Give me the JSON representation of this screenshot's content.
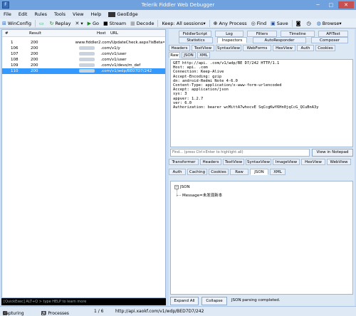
{
  "window": {
    "title": "Telerik Fiddler Web Debugger"
  },
  "menu": [
    "File",
    "Edit",
    "Rules",
    "Tools",
    "View",
    "Help",
    "GeoEdge"
  ],
  "toolbar": {
    "winconfig": "WinConfig",
    "replay": "Replay",
    "go": "Go",
    "stream": "Stream",
    "decode": "Decode",
    "keep": "Keep: All sessions",
    "any_process": "Any Process",
    "find": "Find",
    "save": "Save",
    "browse": "Browse"
  },
  "sessions": {
    "headers": [
      "#",
      "Result",
      "Host",
      "URL"
    ],
    "rows": [
      {
        "id": "1",
        "result": "200",
        "host": "www.fiddler2.com",
        "url": "/UpdateCheck.aspx?isBeta=",
        "selected": false
      },
      {
        "id": "106",
        "result": "200",
        "host": ".com",
        "url": "/v1/y",
        "selected": false
      },
      {
        "id": "107",
        "result": "200",
        "host": ".com",
        "url": "/v1/user",
        "selected": false
      },
      {
        "id": "108",
        "result": "200",
        "host": ".com",
        "url": "/v1/user",
        "selected": false
      },
      {
        "id": "109",
        "result": "200",
        "host": ".com",
        "url": "/v1/devs/m_def",
        "selected": false
      },
      {
        "id": "110",
        "result": "200",
        "host": ".com",
        "url": "/v1/wdp/BE07D7/242",
        "selected": true
      }
    ]
  },
  "quickexec": "[QuickExec] ALT+Q > type HELP to learn more",
  "status": {
    "capturing": "Capturing",
    "processes": "All Processes",
    "count": "1 / 6",
    "url": "http://api.xaokf.com/v1/wdp/BED7D7/242"
  },
  "right": {
    "top_tabs_row1": [
      "FiddlerScript",
      "Log",
      "Filters",
      "Timeline",
      "APITest"
    ],
    "top_tabs_row2": [
      "Statistics",
      "Inspectors",
      "AutoResponder",
      "Composer"
    ],
    "req_tabs_row1": [
      "Headers",
      "TextView",
      "SyntaxView",
      "WebForms",
      "HexView",
      "Auth",
      "Cookies"
    ],
    "req_tabs_row2": [
      "Raw",
      "JSON",
      "XML"
    ],
    "request_lines": [
      "GET http://api.       .com/v1/wdp/BE  D7/242 HTTP/1.1",
      "Host: api.        .com",
      "Connection: Keep-Alive",
      "Accept-Encoding: gzip",
      "dn: android-Redmi Note 4-6.0",
      "Content-Type: application/x-www-form-urlencoded",
      "Accept: application/json",
      "sys: 3",
      "appver: 1.2.7",
      "ver: 6.0",
      "Authorization: bearer wcMittA7whocvE        SqCcgKwY6Hn0jqCcG_QCuBnA3y"
    ],
    "find_placeholder": "Find... (press Ctrl+Enter to highlight all)",
    "view_notepad": "View in Notepad",
    "resp_tabs_row1": [
      "Transformer",
      "Headers",
      "TextView",
      "SyntaxView",
      "ImageView",
      "HexView",
      "WebView"
    ],
    "resp_tabs_row2": [
      "Auth",
      "Caching",
      "Cookies",
      "Raw",
      "JSON",
      "XML"
    ],
    "json_root": "JSON",
    "json_child": "Message=未发现新本",
    "expand_all": "Expand All",
    "collapse": "Collapse",
    "parse_status": "JSON parsing completed."
  }
}
